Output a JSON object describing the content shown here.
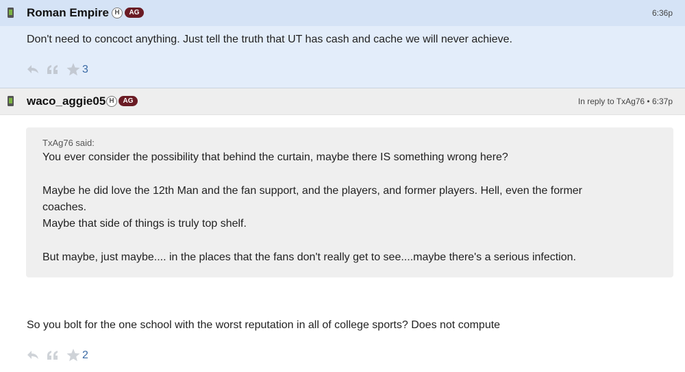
{
  "posts": [
    {
      "username": "Roman Empire",
      "badge_h": "H",
      "badge_ag": "AG",
      "time": "6:36p",
      "text": "Don't need to concoct anything. Just tell the truth that UT has cash and cache we will never achieve.",
      "star_count": "3"
    },
    {
      "username": "waco_aggie05",
      "badge_h": "H",
      "badge_ag": "AG",
      "meta": "In reply to TxAg76 • 6:37p",
      "quote": {
        "attribution": "TxAg76 said:",
        "lines": [
          "You ever consider the possibility that behind the curtain, maybe there IS something wrong here?",
          "Maybe he did love the 12th Man and the fan support, and the players, and former players. Hell, even the former",
          "coaches.",
          "Maybe that side of things is truly top shelf.",
          "But maybe, just maybe.... in the places that the fans don't really get to see....maybe there's a serious infection."
        ]
      },
      "text": "So you bolt for the one school with the worst reputation in all of college sports? Does not compute",
      "star_count": "2"
    }
  ],
  "icons": {
    "device": "phone-icon",
    "reply": "reply-icon",
    "quote": "quote-icon",
    "star": "star-icon"
  },
  "colors": {
    "post1_bg": "#e3edfa",
    "post1_header": "#d5e3f6",
    "post2_header": "#eeeeee",
    "quote_bg": "#efefef",
    "ag_badge": "#6a1b24",
    "phone_green": "#7cb342",
    "count_blue": "#3a6aa5"
  }
}
